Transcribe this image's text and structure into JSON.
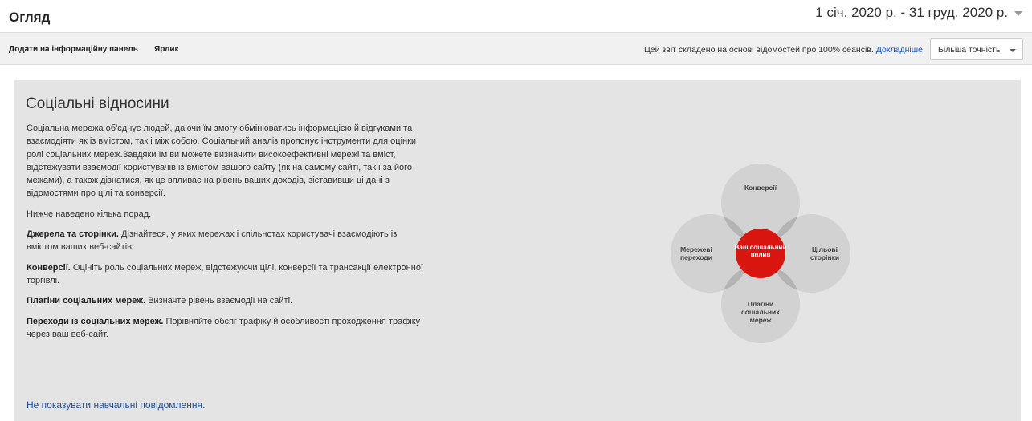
{
  "header": {
    "title": "Огляд",
    "date_range": "1 січ. 2020 р. - 31 груд. 2020 р."
  },
  "toolbar": {
    "add_to_dashboard": "Додати на інформаційну панель",
    "shortcut": "Ярлик",
    "report_note": "Цей звіт складено на основі відомостей про 100% сеансів.",
    "learn_more": "Докладніше",
    "accuracy_label": "Більша точність"
  },
  "panel": {
    "title": "Соціальні відносини",
    "intro": "Соціальна мережа об'єднує людей, даючи їм змогу обмінюватись інформацією й відгуками та взаємодіяти як із вмістом, так і між собою. Соціальний аналіз пропонує інструменти для оцінки ролі соціальних мереж.Завдяки їм ви можете визначити високоефективні мережі та вміст, відстежувати взаємодії користувачів із вмістом вашого сайту (як на самому сайті, так і за його межами), а також дізнатися, як це впливає на рівень ваших доходів, зіставивши ці дані з відомостями про цілі та конверсії.",
    "tips_intro": "Нижче наведено кілька порад.",
    "tips": [
      {
        "title": "Джерела та сторінки.",
        "text": " Дізнайтеся, у яких мережах і спільнотах користувачі взаємодіють із вмістом ваших веб-сайтів."
      },
      {
        "title": "Конверсії.",
        "text": " Оцініть роль соціальних мереж, відстежуючи цілі, конверсії та трансакції електронної торгівлі."
      },
      {
        "title": "Плагіни соціальних мереж.",
        "text": " Визначте рівень взаємодії на сайті."
      },
      {
        "title": "Переходи із соціальних мереж.",
        "text": " Порівняйте обсяг трафіку й особливості проходження трафіку через ваш веб-сайт."
      }
    ],
    "dismiss_link": "Не показувати навчальні повідомлення."
  },
  "diagram": {
    "top": "Конверсії",
    "left": "Мережеві переходи",
    "right": "Цільові сторінки",
    "bottom": "Плагіни соціальних мереж",
    "center": "Ваш соціальний вплив",
    "colors": {
      "circle": "#d2d2d2",
      "overlap": "#b4b4b4",
      "center": "#d8160f"
    }
  }
}
